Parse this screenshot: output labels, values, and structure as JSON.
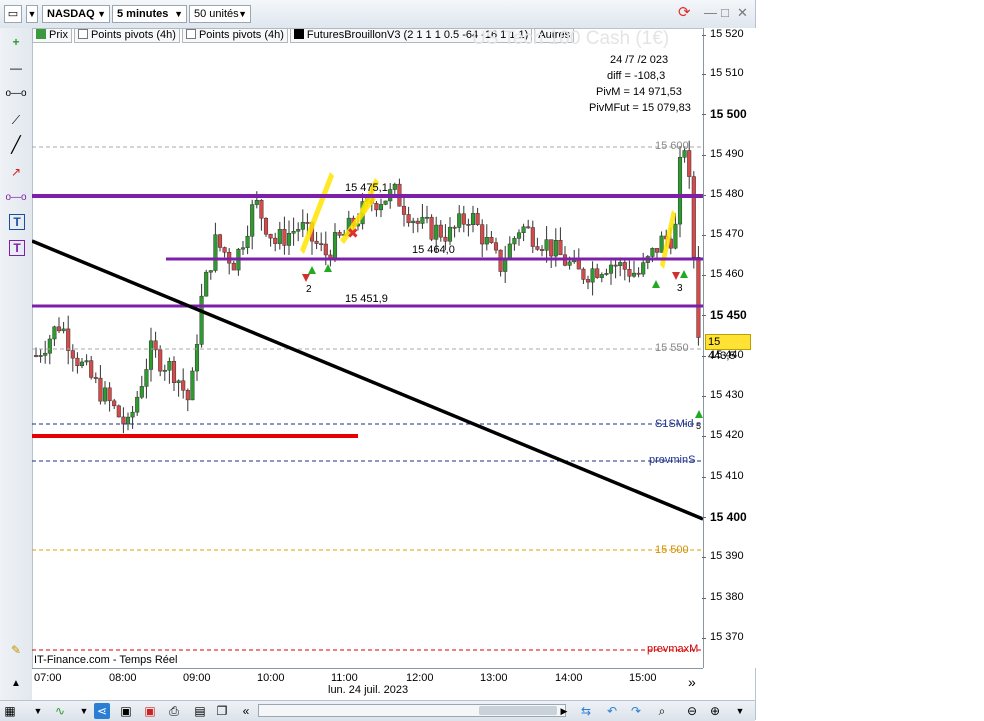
{
  "toolbar": {
    "symbol": "NASDAQ",
    "timeframe": "5 minutes",
    "units": "50 unités"
  },
  "legend": {
    "items": [
      "Prix",
      "Points pivots (4h)",
      "Points pivots (4h)",
      "FuturesBrouillonV3 (2 1 1 1 0.5 -64 -16 1 1 1)",
      "Autres"
    ]
  },
  "watermark": "US Tech 100 Cash (1€)",
  "info_box": {
    "date": "24 /7 /2 023",
    "diff": "diff = -108,3",
    "pivm": "PivM = 14 971,53",
    "pivmfut": "PivMFut = 15 079,83"
  },
  "levels": {
    "l1": "15 600",
    "l2": "15 550",
    "l3": "S1SMid",
    "l4": "prevminS",
    "l5": "15 500",
    "l6": "prevmaxM"
  },
  "annotations": {
    "a1": "15 475,1",
    "a2": "15 464,0",
    "a3": "15 451,9",
    "n2": "2",
    "n3": "3",
    "n5": "5"
  },
  "source": "IT-Finance.com - Temps Réel",
  "price_axis": {
    "ticks": [
      "15 520",
      "15 510",
      "15 500",
      "15 490",
      "15 480",
      "15 470",
      "15 460",
      "15 450",
      "15 440",
      "15 430",
      "15 420",
      "15 410",
      "15 400",
      "15 390",
      "15 380",
      "15 370"
    ],
    "current": "15 443,5"
  },
  "time_axis": {
    "ticks": [
      "07:00",
      "08:00",
      "09:00",
      "10:00",
      "11:00",
      "12:00",
      "13:00",
      "14:00",
      "15:00"
    ],
    "date": "lun. 24 juil. 2023"
  },
  "colors": {
    "up": "#2e9b2e",
    "down": "#d64a4a",
    "purple": "#7d1fa8",
    "red_line": "#e60000",
    "trend": "#000000"
  },
  "icons": {
    "refresh": "refresh-icon",
    "minimize": "minimize-icon",
    "maximize": "maximize-icon",
    "close": "close-icon"
  }
}
